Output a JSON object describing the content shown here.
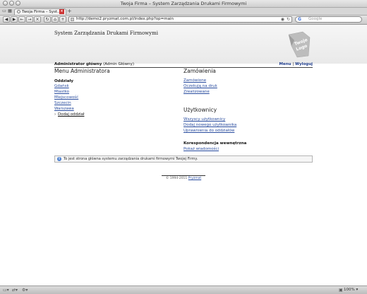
{
  "window": {
    "title": "Twoja Firma – System Zarządzania Drukami Firmowymi"
  },
  "tabs": [
    {
      "label": "Twoja Firma – Syst…"
    }
  ],
  "navigation": {
    "url": "http://demo2.pryzmat.com.pl/index.php?op=main",
    "search_placeholder": "Google"
  },
  "header": {
    "system_name": "System Zarządzania Drukami Firmowymi",
    "logo_text_1": "Twoje",
    "logo_text_2": "Logo"
  },
  "userline": {
    "user_role": "Administrator główny",
    "user_detail": "(Admin Główny)",
    "menu_link": "Menu",
    "separator": "|",
    "logout_link": "Wyloguj"
  },
  "left_column": {
    "title": "Menu Administratora",
    "section_title": "Oddziały",
    "branches": [
      "Gdańsk",
      "Miastko",
      "Miejscowość",
      "Szczecin",
      "Warszawa"
    ],
    "add_branch": "Dodaj oddział"
  },
  "right_column": {
    "orders_title": "Zamówienia",
    "orders_links": [
      "Zamówione",
      "Oczekują na druk",
      "Zrealizowane"
    ],
    "users_title": "Użytkownicy",
    "users_links": [
      "Wszyscy użytkownicy",
      "Dodaj nowego użytkownika",
      "Uprawnienia do oddziałów"
    ],
    "correspondence_title": "Korespondencja wewnętrzna",
    "correspondence_links": [
      "Pokaż wiadomości"
    ]
  },
  "info": {
    "message": "To jest strona główna systemu zarządzania drukami firmowymi Twojej Firmy."
  },
  "footer": {
    "copyright": "© 1994-2011",
    "company": "Pryzmat"
  },
  "statusbar": {
    "zoom": "100%"
  },
  "colors": {
    "link": "#2a4d9f",
    "info_icon": "#4a7fd0"
  }
}
